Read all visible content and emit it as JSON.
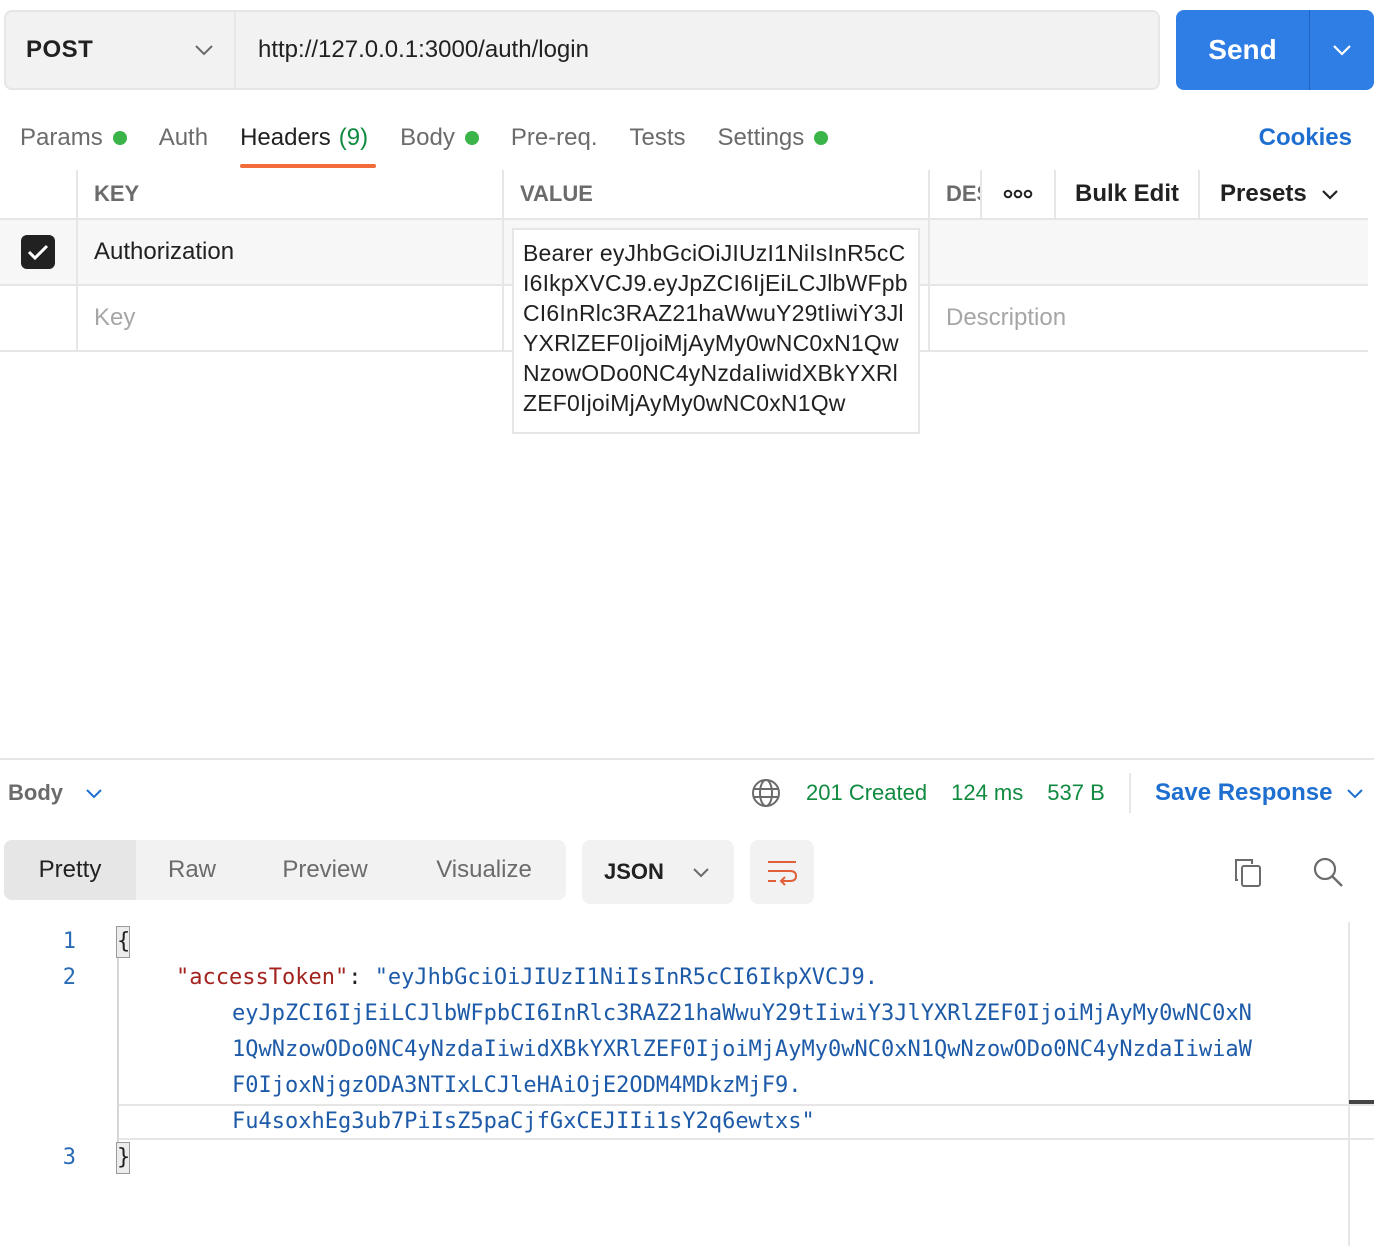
{
  "request": {
    "method": "POST",
    "url": "http://127.0.0.1:3000/auth/login",
    "send_label": "Send"
  },
  "tabs": [
    {
      "label": "Params",
      "dot": true
    },
    {
      "label": "Auth",
      "dot": false
    },
    {
      "label": "Headers",
      "count": "(9)",
      "active": true
    },
    {
      "label": "Body",
      "dot": true
    },
    {
      "label": "Pre-req.",
      "dot": false
    },
    {
      "label": "Tests",
      "dot": false
    },
    {
      "label": "Settings",
      "dot": true
    }
  ],
  "cookies_label": "Cookies",
  "headers_table": {
    "columns": {
      "key": "KEY",
      "value": "VALUE",
      "description": "DESCRIPTION"
    },
    "bulk_edit": "Bulk Edit",
    "presets": "Presets",
    "rows": [
      {
        "checked": true,
        "key": "Authorization",
        "value": "Bearer eyJhbGciOiJIUzI1NiIsInR5cCI6IkpXVCJ9.eyJpZCI6IjEiLCJlbWFpbCI6InRlc3RAZ21haWwuY29tIiwiY3JlYXRlZEF0IjoiMjAyMy0wNC0xN1QwNzowODo0NC4yNzdaIiwidXBkYXRlZEF0IjoiMjAyMy0wNC0xN1Qw"
      }
    ],
    "placeholder": {
      "key": "Key",
      "description": "Description"
    }
  },
  "response": {
    "body_label": "Body",
    "status": "201 Created",
    "time": "124 ms",
    "size": "537 B",
    "save_label": "Save Response",
    "views": [
      "Pretty",
      "Raw",
      "Preview",
      "Visualize"
    ],
    "active_view": "Pretty",
    "format": "JSON",
    "code": {
      "line_numbers": [
        "1",
        "2",
        "3"
      ],
      "open_brace": "{",
      "close_brace": "}",
      "key": "\"accessToken\"",
      "colon": ": ",
      "value_lines": [
        "\"eyJhbGciOiJIUzI1NiIsInR5cCI6IkpXVCJ9.",
        "eyJpZCI6IjEiLCJlbWFpbCI6InRlc3RAZ21haWwuY29tIiwiY3JlYXRlZEF0IjoiMjAyMy0wNC0xN",
        "1QwNzowODo0NC4yNzdaIiwidXBkYXRlZEF0IjoiMjAyMy0wNC0xN1QwNzowODo0NC4yNzdaIiwiaW",
        "F0IjoxNjgzODA3NTIxLCJleHAiOjE2ODM4MDkzMjF9.",
        "Fu4soxhEg3ub7PiIsZ5paCjfGxCEJIIi1sY2q6ewtxs\""
      ]
    }
  },
  "colors": {
    "accent": "#2f7ee6",
    "active_tab_underline": "#f26b3a",
    "status_green": "#0f8a3f",
    "link_blue": "#1f6fd1",
    "json_key": "#a3231f",
    "json_string": "#1d5aa8"
  },
  "icons": {
    "method_caret": "chevron-down-icon",
    "send_caret": "chevron-down-icon",
    "more": "more-horizontal-icon",
    "checkbox": "check-icon",
    "globe": "globe-icon",
    "wrap": "wrap-lines-icon",
    "copy": "copy-icon",
    "search": "search-icon"
  }
}
